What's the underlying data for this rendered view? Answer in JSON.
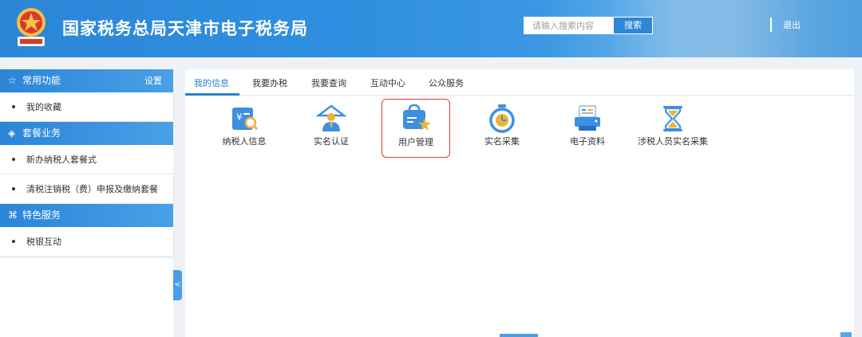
{
  "header": {
    "site_title": "国家税务总局天津市电子税务局",
    "search_placeholder": "请输入搜索内容",
    "search_button": "搜索",
    "logout": "退出"
  },
  "sidebar": {
    "sections": [
      {
        "icon": "star-icon",
        "title": "常用功能",
        "action": "设置",
        "items": [
          "我的收藏"
        ]
      },
      {
        "icon": "layers-icon",
        "title": "套餐业务",
        "items": [
          "新办纳税人套餐式",
          "清税注销税（费）申报及缴纳套餐"
        ]
      },
      {
        "icon": "grid-icon",
        "title": "特色服务",
        "items": [
          "税银互动"
        ]
      }
    ],
    "collapse_glyph": "<"
  },
  "main": {
    "tabs": [
      "我的信息",
      "我要办税",
      "我要查询",
      "互动中心",
      "公众服务"
    ],
    "active_tab": "我的信息",
    "tiles": [
      {
        "icon": "taxpayer-info-icon",
        "label": "纳税人信息"
      },
      {
        "icon": "realname-auth-icon",
        "label": "实名认证"
      },
      {
        "icon": "user-management-icon",
        "label": "用户管理",
        "selected": true
      },
      {
        "icon": "stopwatch-icon",
        "label": "实名采集"
      },
      {
        "icon": "printer-icon",
        "label": "电子资料"
      },
      {
        "icon": "hourglass-icon",
        "label": "涉税人员实名采集"
      }
    ]
  },
  "colors": {
    "header_blue": "#2b86d8",
    "accent": "#2a7fd4",
    "highlight_border": "#e03a3a"
  }
}
